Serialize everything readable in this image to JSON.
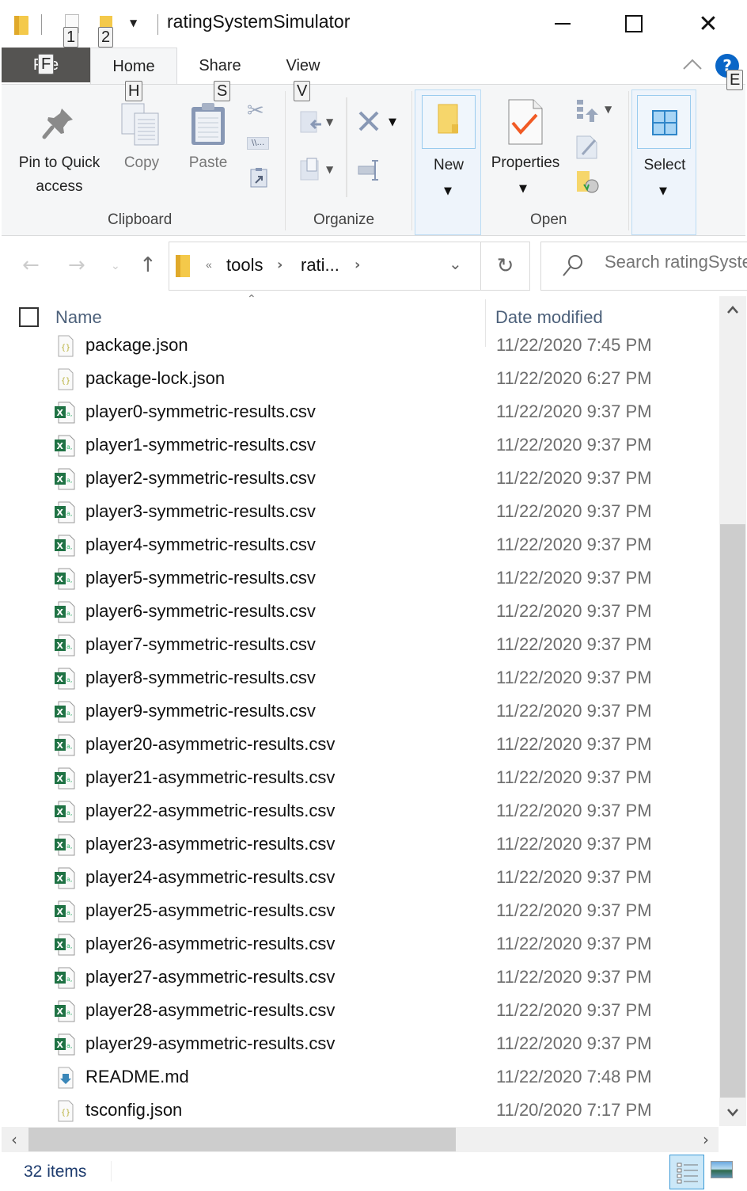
{
  "window": {
    "title": "ratingSystemSimulator",
    "quick_access_keytips": [
      "1",
      "2"
    ]
  },
  "ribbon_tabs": [
    {
      "label": "File",
      "keytip": "F"
    },
    {
      "label": "Home",
      "keytip": "H"
    },
    {
      "label": "Share",
      "keytip": "S"
    },
    {
      "label": "View",
      "keytip": "V"
    }
  ],
  "help_keytip": "E",
  "ribbon": {
    "clipboard": {
      "group_label": "Clipboard",
      "pin_label_line1": "Pin to Quick",
      "pin_label_line2": "access",
      "copy_label": "Copy",
      "paste_label": "Paste",
      "copy_path_label": "\\\\..."
    },
    "organize": {
      "group_label": "Organize"
    },
    "new": {
      "label": "New"
    },
    "open": {
      "group_label": "Open",
      "properties_label": "Properties"
    },
    "select": {
      "label": "Select"
    }
  },
  "address_bar": {
    "overflow": "«",
    "crumbs": [
      "tools",
      "rati..."
    ],
    "search_placeholder": "Search ratingSystemSimulator"
  },
  "columns": {
    "name": "Name",
    "date_modified": "Date modified"
  },
  "files": [
    {
      "name": "package.json",
      "date": "11/22/2020 7:45 PM",
      "type": "json"
    },
    {
      "name": "package-lock.json",
      "date": "11/22/2020 6:27 PM",
      "type": "json"
    },
    {
      "name": "player0-symmetric-results.csv",
      "date": "11/22/2020 9:37 PM",
      "type": "csv"
    },
    {
      "name": "player1-symmetric-results.csv",
      "date": "11/22/2020 9:37 PM",
      "type": "csv"
    },
    {
      "name": "player2-symmetric-results.csv",
      "date": "11/22/2020 9:37 PM",
      "type": "csv"
    },
    {
      "name": "player3-symmetric-results.csv",
      "date": "11/22/2020 9:37 PM",
      "type": "csv"
    },
    {
      "name": "player4-symmetric-results.csv",
      "date": "11/22/2020 9:37 PM",
      "type": "csv"
    },
    {
      "name": "player5-symmetric-results.csv",
      "date": "11/22/2020 9:37 PM",
      "type": "csv"
    },
    {
      "name": "player6-symmetric-results.csv",
      "date": "11/22/2020 9:37 PM",
      "type": "csv"
    },
    {
      "name": "player7-symmetric-results.csv",
      "date": "11/22/2020 9:37 PM",
      "type": "csv"
    },
    {
      "name": "player8-symmetric-results.csv",
      "date": "11/22/2020 9:37 PM",
      "type": "csv"
    },
    {
      "name": "player9-symmetric-results.csv",
      "date": "11/22/2020 9:37 PM",
      "type": "csv"
    },
    {
      "name": "player20-asymmetric-results.csv",
      "date": "11/22/2020 9:37 PM",
      "type": "csv"
    },
    {
      "name": "player21-asymmetric-results.csv",
      "date": "11/22/2020 9:37 PM",
      "type": "csv"
    },
    {
      "name": "player22-asymmetric-results.csv",
      "date": "11/22/2020 9:37 PM",
      "type": "csv"
    },
    {
      "name": "player23-asymmetric-results.csv",
      "date": "11/22/2020 9:37 PM",
      "type": "csv"
    },
    {
      "name": "player24-asymmetric-results.csv",
      "date": "11/22/2020 9:37 PM",
      "type": "csv"
    },
    {
      "name": "player25-asymmetric-results.csv",
      "date": "11/22/2020 9:37 PM",
      "type": "csv"
    },
    {
      "name": "player26-asymmetric-results.csv",
      "date": "11/22/2020 9:37 PM",
      "type": "csv"
    },
    {
      "name": "player27-asymmetric-results.csv",
      "date": "11/22/2020 9:37 PM",
      "type": "csv"
    },
    {
      "name": "player28-asymmetric-results.csv",
      "date": "11/22/2020 9:37 PM",
      "type": "csv"
    },
    {
      "name": "player29-asymmetric-results.csv",
      "date": "11/22/2020 9:37 PM",
      "type": "csv"
    },
    {
      "name": "README.md",
      "date": "11/22/2020 7:48 PM",
      "type": "md"
    },
    {
      "name": "tsconfig.json",
      "date": "11/20/2020 7:17 PM",
      "type": "json"
    }
  ],
  "status": {
    "item_count": "32 items"
  },
  "colors": {
    "file_tab_bg": "#555452",
    "help_blue": "#0a66c7",
    "excel_green": "#1f7244",
    "folder_yellow": "#f4c94a",
    "header_text": "#4c607a",
    "date_text": "#6d6d6d",
    "selected_view": "#cce8f8"
  }
}
